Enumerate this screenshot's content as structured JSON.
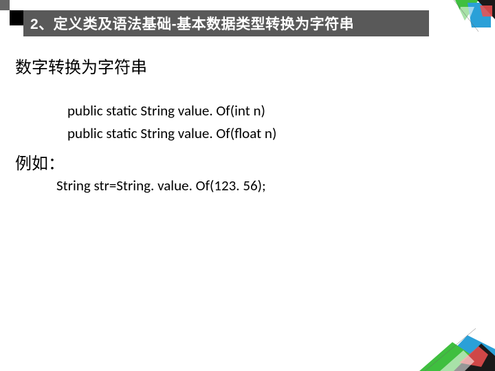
{
  "header": {
    "title": "2、定义类及语法基础-基本数据类型转换为字符串"
  },
  "body": {
    "section_title": "数字转换为字符串",
    "code_lines": [
      "public static String value. Of(int n)",
      "public static String value. Of(float n)"
    ],
    "example_label": "例如：",
    "example_code": "String str=String. value. Of(123. 56);"
  }
}
